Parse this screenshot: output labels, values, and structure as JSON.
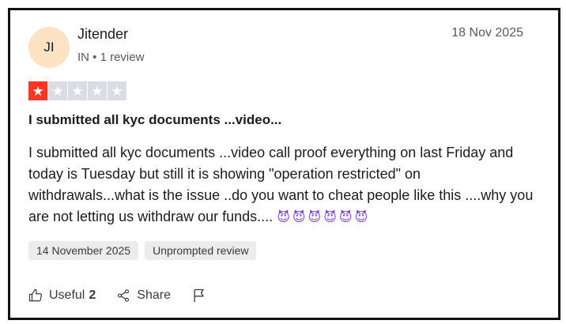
{
  "reviewer": {
    "initials": "JI",
    "name": "Jitender",
    "meta": "IN • 1 review"
  },
  "review": {
    "date": "18 Nov 2025",
    "rating": 1,
    "max_rating": 5,
    "title": "I submitted all kyc documents ...video...",
    "body": "I submitted all kyc documents ...video call proof everything on last Friday and today is Tuesday but still it is showing \"operation restricted\" on withdrawals...what is the issue ..do you want to cheat people like this ....why you are not letting us withdraw our funds....",
    "emoji_trail": "😈😈😈😈😈😈",
    "experience_date": "14 November 2025",
    "review_type": "Unprompted review"
  },
  "actions": {
    "useful_label": "Useful",
    "useful_count": "2",
    "share_label": "Share"
  },
  "colors": {
    "star_filled": "#ff3722",
    "star_empty": "#dcdce6",
    "avatar_bg": "#fde3c3"
  },
  "icons": [
    "thumbs-up-icon",
    "share-icon",
    "flag-icon",
    "star-icon"
  ]
}
